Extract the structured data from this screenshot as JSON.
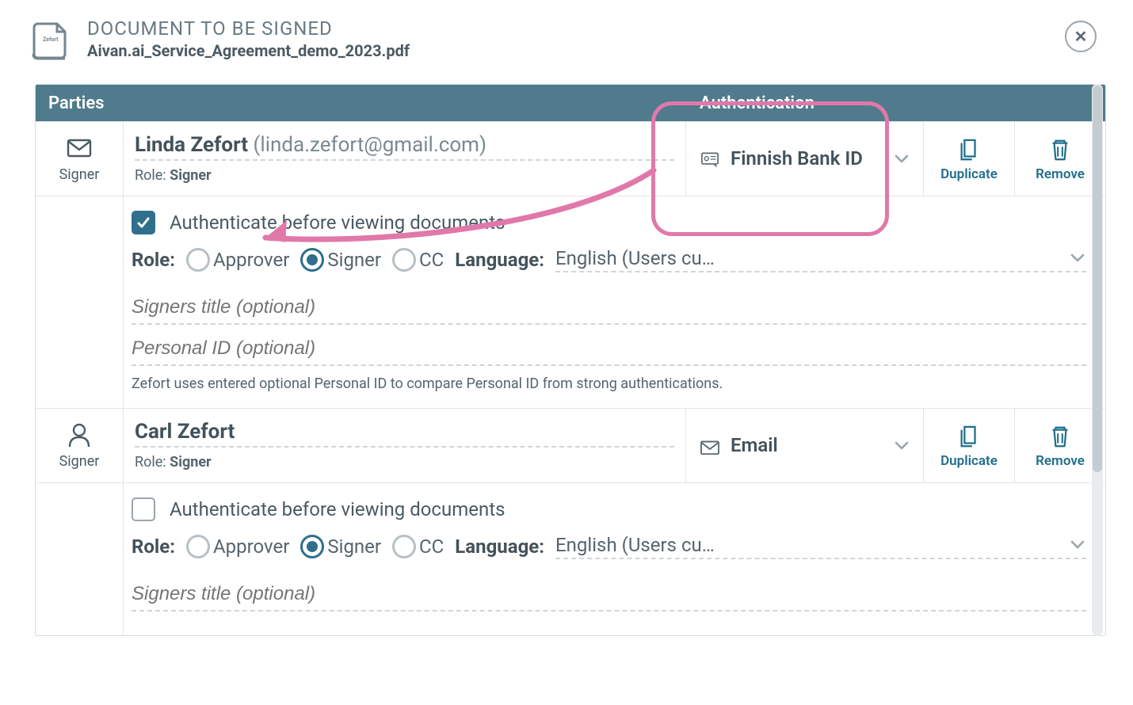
{
  "modal": {
    "top_label": "DOCUMENT TO BE SIGNED",
    "filename": "Aivan.ai_Service_Agreement_demo_2023.pdf",
    "close_glyph": "✕"
  },
  "columns": {
    "parties": "Parties",
    "authentication": "Authentication"
  },
  "actions": {
    "duplicate": "Duplicate",
    "remove": "Remove"
  },
  "common": {
    "signer_label": "Signer",
    "role_prefix": "Role: ",
    "auth_checkbox_label": "Authenticate before viewing documents",
    "role_field_label": "Role:",
    "language_field_label": "Language:",
    "role_options": {
      "approver": "Approver",
      "signer": "Signer",
      "cc": "CC"
    },
    "signers_title_placeholder": "Signers title (optional)",
    "personal_id_placeholder": "Personal ID (optional)",
    "personal_id_help": "Zefort uses entered optional Personal ID to compare Personal ID from strong authentications."
  },
  "parties": [
    {
      "icon": "envelope",
      "name": "Linda Zefort",
      "email": "(linda.zefort@gmail.com)",
      "role": "Signer",
      "authentication": "Finnish Bank ID",
      "auth_icon": "id-card",
      "auth_before_view": true,
      "selected_role": "Signer",
      "language": "English (Users cu…"
    },
    {
      "icon": "person",
      "name": "Carl Zefort",
      "email": "",
      "role": "Signer",
      "authentication": "Email",
      "auth_icon": "envelope",
      "auth_before_view": false,
      "selected_role": "Signer",
      "language": "English (Users cu…"
    }
  ]
}
